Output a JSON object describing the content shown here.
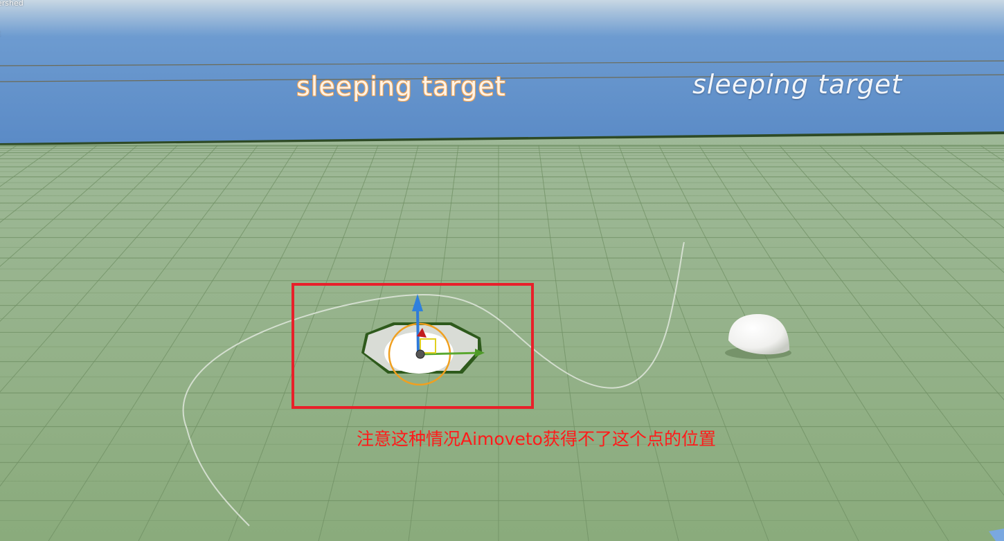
{
  "viewport": {
    "stats": {
      "line1": "ershed",
      "line2": "t"
    },
    "labels": [
      {
        "text": "sleeping target"
      },
      {
        "text": "sleeping target"
      }
    ],
    "gizmo": {
      "axes": [
        "x",
        "y",
        "z"
      ]
    }
  },
  "annotation": {
    "text": "注意这种情况Aimoveto获得不了这个点的位置",
    "color": "#ff1a1a"
  },
  "colors": {
    "sky": "#5b8fc9",
    "floor": "#8fb083",
    "selection_outline": "#2e5a1c",
    "pivot_ring": "#f0a020",
    "annotation_box": "#e8202a"
  }
}
